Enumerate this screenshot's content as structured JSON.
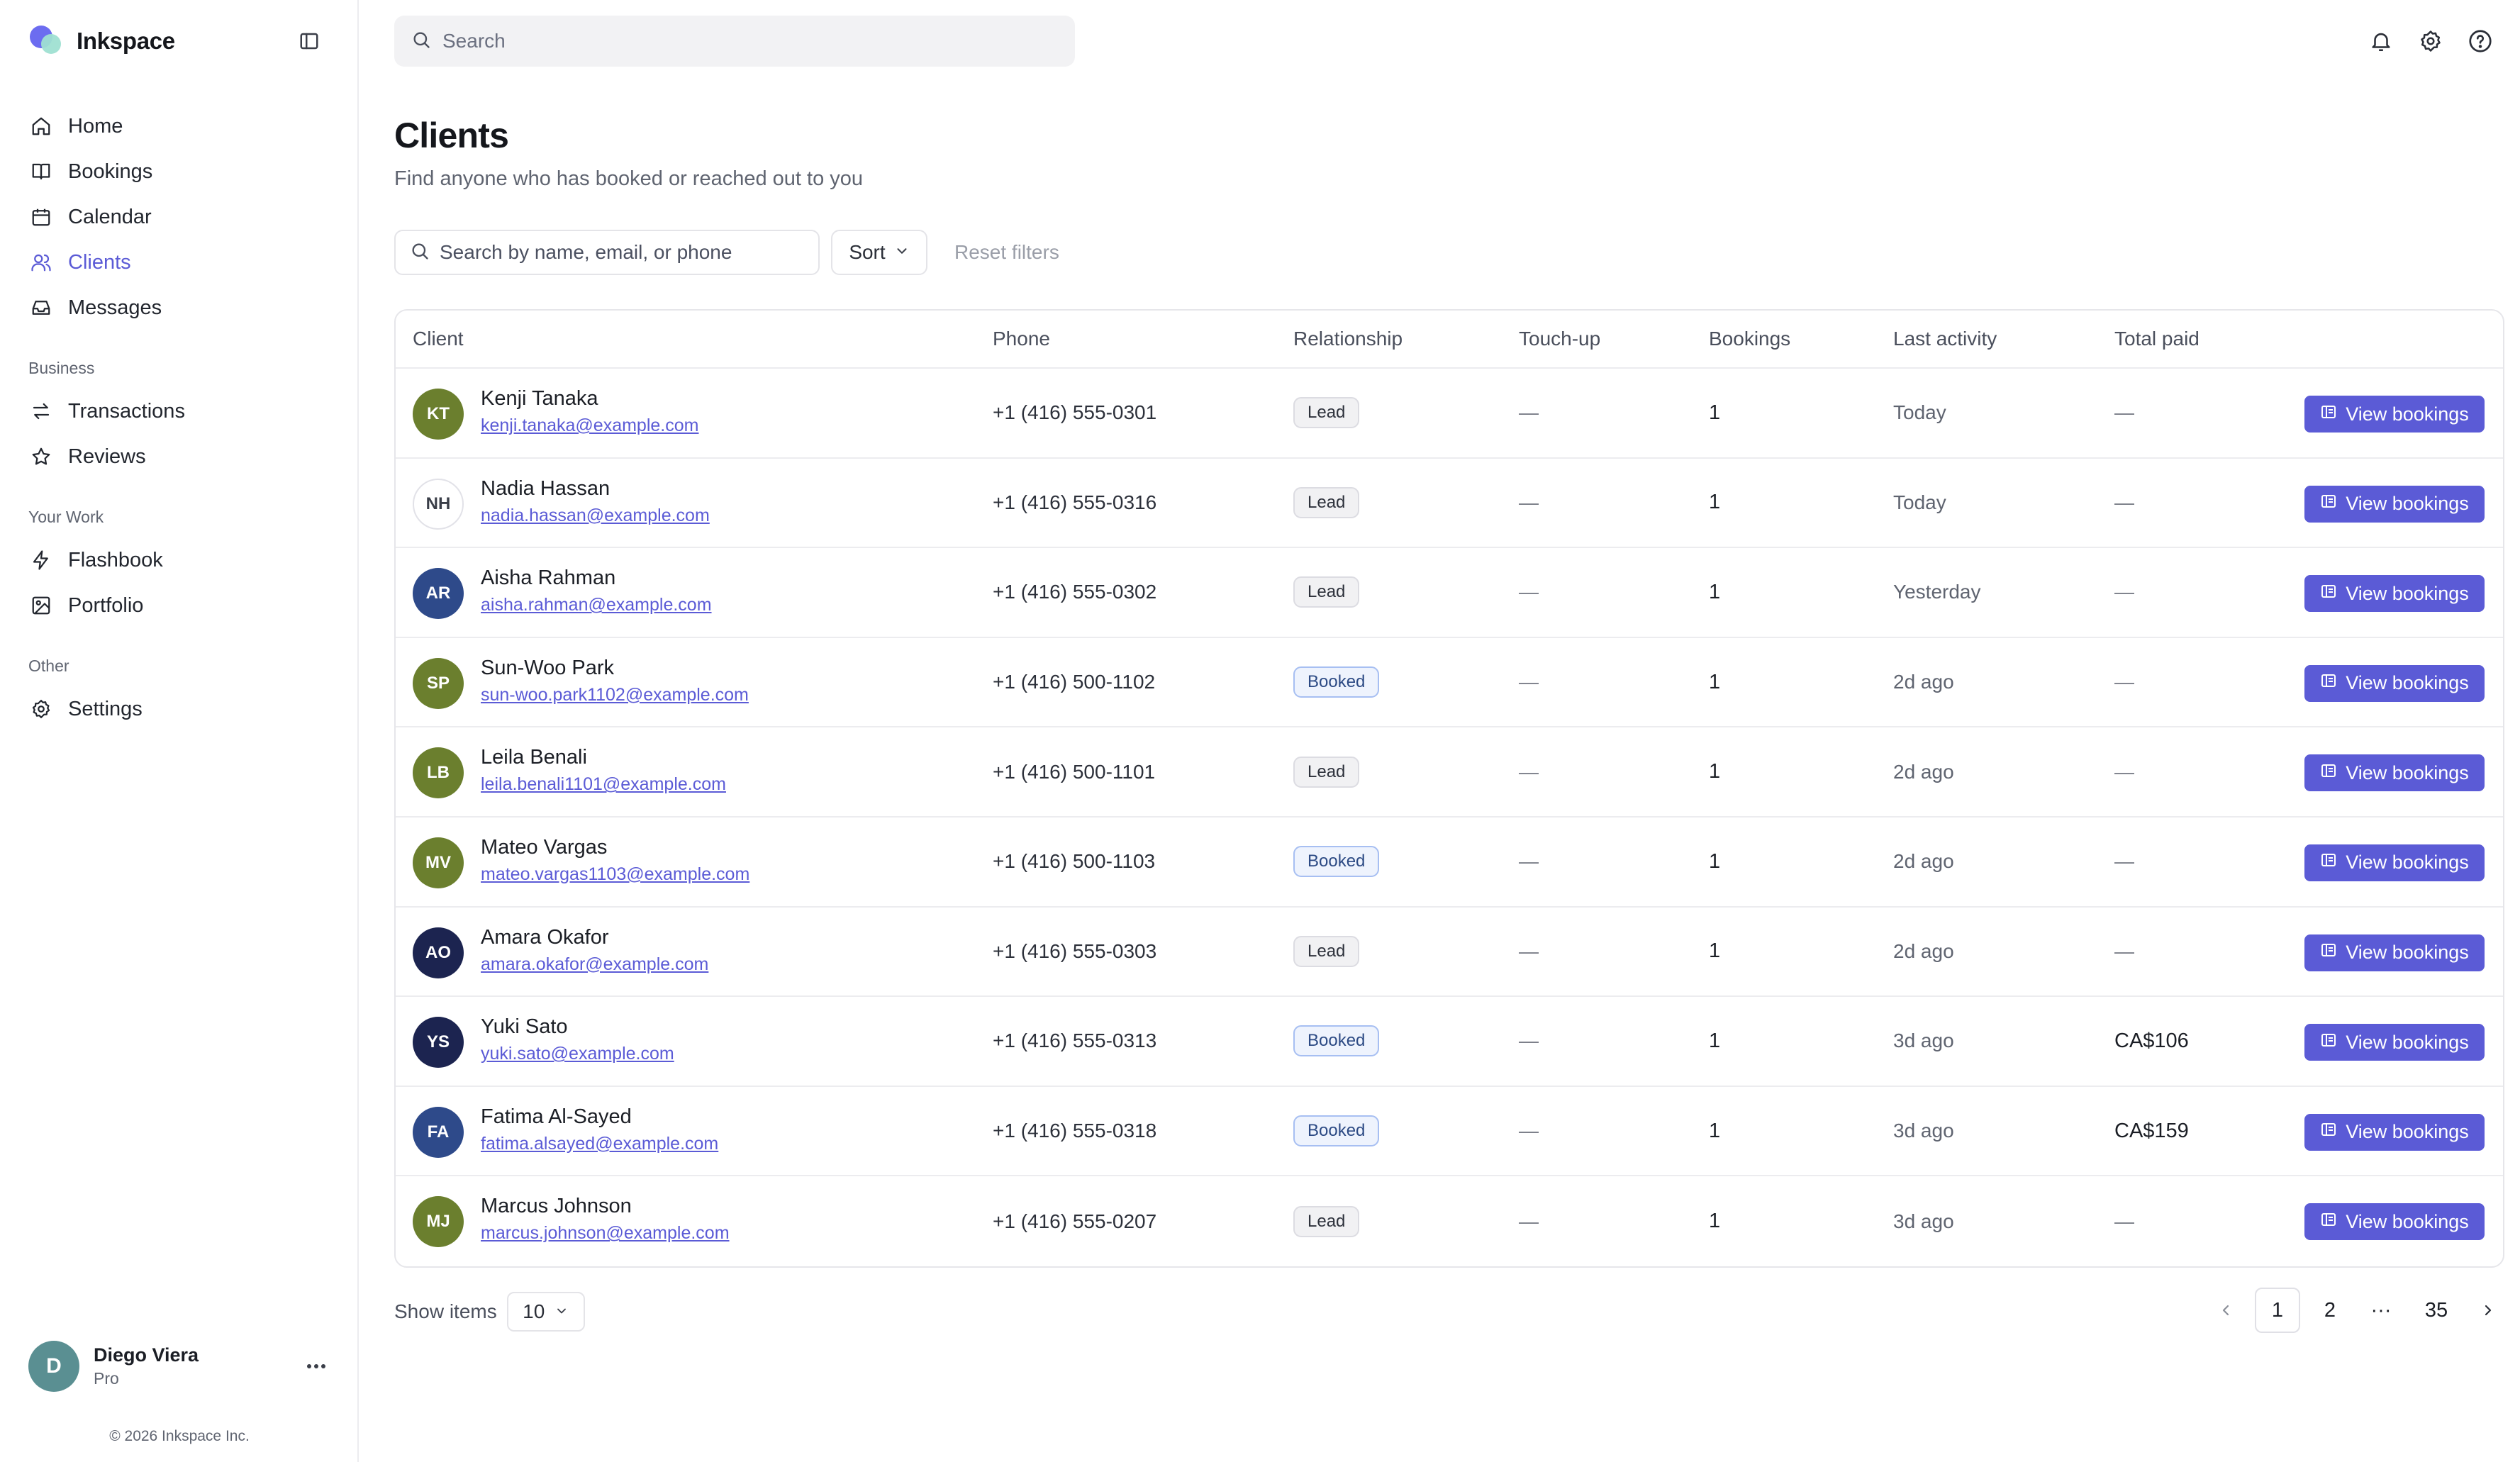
{
  "app": {
    "name": "Inkspace"
  },
  "sidebar": {
    "primary": [
      {
        "label": "Home",
        "icon": "home-icon",
        "active": false
      },
      {
        "label": "Bookings",
        "icon": "book-icon",
        "active": false
      },
      {
        "label": "Calendar",
        "icon": "calendar-icon",
        "active": false
      },
      {
        "label": "Clients",
        "icon": "users-icon",
        "active": true
      },
      {
        "label": "Messages",
        "icon": "inbox-icon",
        "active": false
      }
    ],
    "business_heading": "Business",
    "business": [
      {
        "label": "Transactions",
        "icon": "transfer-icon"
      },
      {
        "label": "Reviews",
        "icon": "star-icon"
      }
    ],
    "work_heading": "Your Work",
    "work": [
      {
        "label": "Flashbook",
        "icon": "bolt-icon"
      },
      {
        "label": "Portfolio",
        "icon": "image-icon"
      }
    ],
    "other_heading": "Other",
    "other": [
      {
        "label": "Settings",
        "icon": "gear-icon"
      }
    ],
    "user": {
      "initial": "D",
      "name": "Diego Viera",
      "plan": "Pro",
      "avatar_color": "#5a8f92"
    },
    "copyright": "© 2026 Inkspace Inc."
  },
  "topbar": {
    "search_placeholder": "Search",
    "icons": [
      "bell-icon",
      "gear-icon",
      "help-icon"
    ]
  },
  "page": {
    "title": "Clients",
    "subtitle": "Find anyone who has booked or reached out to you"
  },
  "filters": {
    "search_placeholder": "Search by name, email, or phone",
    "sort_label": "Sort",
    "reset_label": "Reset filters"
  },
  "table": {
    "columns": [
      "Client",
      "Phone",
      "Relationship",
      "Touch-up",
      "Bookings",
      "Last activity",
      "Total paid"
    ],
    "action_label": "View bookings",
    "rows": [
      {
        "initials": "KT",
        "avatar_color": "#6b7f2e",
        "name": "Kenji Tanaka",
        "email": "kenji.tanaka@example.com",
        "phone": "+1 (416) 555-0301",
        "relationship": "Lead",
        "touchup": "—",
        "bookings": "1",
        "last_activity": "Today",
        "total_paid": "—"
      },
      {
        "initials": "NH",
        "avatar_color": "#ffffff",
        "name": "Nadia Hassan",
        "email": "nadia.hassan@example.com",
        "phone": "+1 (416) 555-0316",
        "relationship": "Lead",
        "touchup": "—",
        "bookings": "1",
        "last_activity": "Today",
        "total_paid": "—"
      },
      {
        "initials": "AR",
        "avatar_color": "#2e4a8a",
        "name": "Aisha Rahman",
        "email": "aisha.rahman@example.com",
        "phone": "+1 (416) 555-0302",
        "relationship": "Lead",
        "touchup": "—",
        "bookings": "1",
        "last_activity": "Yesterday",
        "total_paid": "—"
      },
      {
        "initials": "SP",
        "avatar_color": "#6b7f2e",
        "name": "Sun-Woo Park",
        "email": "sun-woo.park1102@example.com",
        "phone": "+1 (416) 500-1102",
        "relationship": "Booked",
        "touchup": "—",
        "bookings": "1",
        "last_activity": "2d ago",
        "total_paid": "—"
      },
      {
        "initials": "LB",
        "avatar_color": "#6b7f2e",
        "name": "Leila Benali",
        "email": "leila.benali1101@example.com",
        "phone": "+1 (416) 500-1101",
        "relationship": "Lead",
        "touchup": "—",
        "bookings": "1",
        "last_activity": "2d ago",
        "total_paid": "—"
      },
      {
        "initials": "MV",
        "avatar_color": "#6b7f2e",
        "name": "Mateo Vargas",
        "email": "mateo.vargas1103@example.com",
        "phone": "+1 (416) 500-1103",
        "relationship": "Booked",
        "touchup": "—",
        "bookings": "1",
        "last_activity": "2d ago",
        "total_paid": "—"
      },
      {
        "initials": "AO",
        "avatar_color": "#1c2450",
        "name": "Amara Okafor",
        "email": "amara.okafor@example.com",
        "phone": "+1 (416) 555-0303",
        "relationship": "Lead",
        "touchup": "—",
        "bookings": "1",
        "last_activity": "2d ago",
        "total_paid": "—"
      },
      {
        "initials": "YS",
        "avatar_color": "#1c2450",
        "name": "Yuki Sato",
        "email": "yuki.sato@example.com",
        "phone": "+1 (416) 555-0313",
        "relationship": "Booked",
        "touchup": "—",
        "bookings": "1",
        "last_activity": "3d ago",
        "total_paid": "CA$106"
      },
      {
        "initials": "FA",
        "avatar_color": "#2e4a8a",
        "name": "Fatima Al-Sayed",
        "email": "fatima.alsayed@example.com",
        "phone": "+1 (416) 555-0318",
        "relationship": "Booked",
        "touchup": "—",
        "bookings": "1",
        "last_activity": "3d ago",
        "total_paid": "CA$159"
      },
      {
        "initials": "MJ",
        "avatar_color": "#6b7f2e",
        "name": "Marcus Johnson",
        "email": "marcus.johnson@example.com",
        "phone": "+1 (416) 555-0207",
        "relationship": "Lead",
        "touchup": "—",
        "bookings": "1",
        "last_activity": "3d ago",
        "total_paid": "—"
      }
    ]
  },
  "footer": {
    "show_items_label": "Show items",
    "per_page": "10",
    "pages": [
      "1",
      "2",
      "35"
    ],
    "ellipsis": "···",
    "current_page": "1"
  },
  "colors": {
    "accent": "#5b5bd6",
    "lead_badge": "#f1f1f3",
    "booked_badge": "#eef3fd"
  }
}
